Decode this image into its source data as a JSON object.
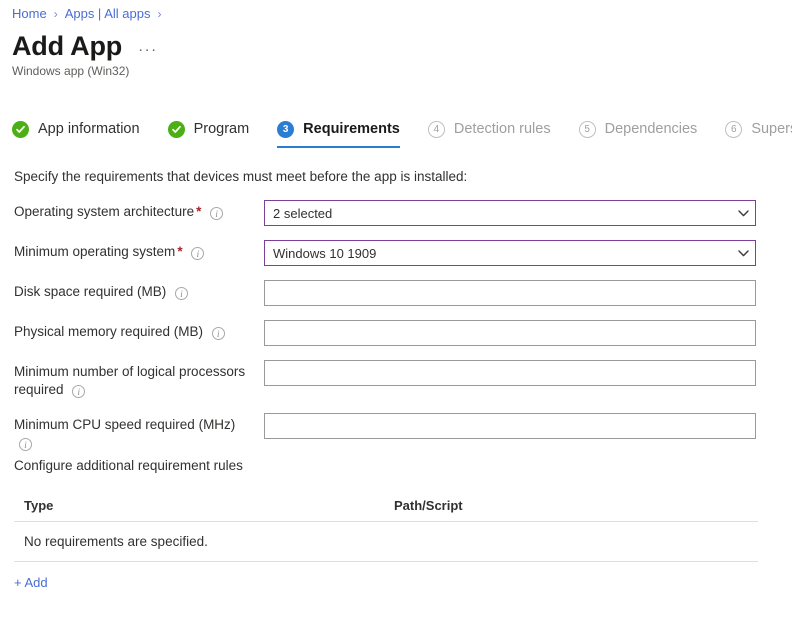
{
  "breadcrumb": {
    "items": [
      {
        "label": "Home"
      },
      {
        "label": "Apps | All apps"
      }
    ],
    "separator": "›"
  },
  "header": {
    "title": "Add App",
    "overflow_label": "···",
    "subtitle": "Windows app (Win32)"
  },
  "wizard": {
    "tabs": [
      {
        "num": "1",
        "label": "App information",
        "state": "done"
      },
      {
        "num": "2",
        "label": "Program",
        "state": "done"
      },
      {
        "num": "3",
        "label": "Requirements",
        "state": "active"
      },
      {
        "num": "4",
        "label": "Detection rules",
        "state": "todo"
      },
      {
        "num": "5",
        "label": "Dependencies",
        "state": "todo"
      },
      {
        "num": "6",
        "label": "Supersede",
        "state": "todo"
      }
    ]
  },
  "main": {
    "intro": "Specify the requirements that devices must meet before the app is installed:",
    "fields": [
      {
        "label": "Operating system architecture",
        "required": true,
        "info": true,
        "type": "dropdown",
        "value": "2 selected",
        "placeholder": ""
      },
      {
        "label": "Minimum operating system",
        "required": true,
        "info": true,
        "type": "dropdown",
        "value": "Windows 10 1909",
        "placeholder": ""
      },
      {
        "label": "Disk space required (MB)",
        "required": false,
        "info": true,
        "type": "textbox",
        "value": "",
        "placeholder": ""
      },
      {
        "label": "Physical memory required (MB)",
        "required": false,
        "info": true,
        "type": "textbox",
        "value": "",
        "placeholder": ""
      },
      {
        "label": "Minimum number of logical processors required",
        "required": false,
        "info": true,
        "type": "textbox",
        "value": "",
        "placeholder": ""
      },
      {
        "label": "Minimum CPU speed required (MHz)",
        "required": false,
        "info": true,
        "type": "textbox",
        "value": "",
        "placeholder": ""
      }
    ],
    "config_section_label": "Configure additional requirement rules",
    "table": {
      "columns": [
        "Type",
        "Path/Script"
      ],
      "rows": [],
      "empty_message": "No requirements are specified."
    },
    "add_label": "+ Add"
  },
  "colors": {
    "link": "#4a6dd4",
    "accent_blue": "#2b7cd3",
    "success_green": "#4caf16",
    "focus_purple": "#7e3f98",
    "required_red": "#a4262c",
    "muted_gray": "#a19f9d"
  }
}
